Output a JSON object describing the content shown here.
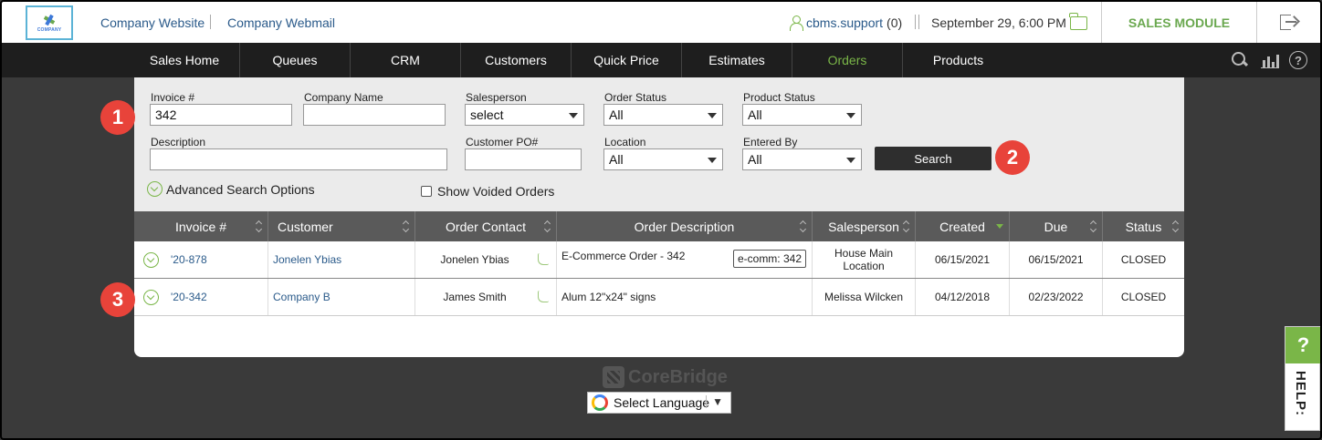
{
  "header": {
    "logo_text": "COMPANY",
    "links": [
      "Company Website",
      "Company Webmail"
    ],
    "user_name": "cbms.support",
    "user_count": "(0)",
    "datetime": "September 29, 6:00 PM",
    "module": "SALES MODULE"
  },
  "nav": {
    "items": [
      "Sales Home",
      "Queues",
      "CRM",
      "Customers",
      "Quick Price",
      "Estimates",
      "Orders",
      "Products"
    ],
    "active": "Orders"
  },
  "filters": {
    "invoice_label": "Invoice #",
    "invoice_value": "342",
    "company_label": "Company Name",
    "company_value": "",
    "salesperson_label": "Salesperson",
    "salesperson_value": "select",
    "order_status_label": "Order Status",
    "order_status_value": "All",
    "product_status_label": "Product Status",
    "product_status_value": "All",
    "description_label": "Description",
    "description_value": "",
    "customer_po_label": "Customer PO#",
    "customer_po_value": "",
    "location_label": "Location",
    "location_value": "All",
    "entered_by_label": "Entered By",
    "entered_by_value": "All",
    "search_label": "Search",
    "advanced_label": "Advanced Search Options",
    "voided_label": "Show Voided Orders"
  },
  "table": {
    "columns": [
      "Invoice #",
      "Customer",
      "Order Contact",
      "Order Description",
      "Salesperson",
      "Created",
      "Due",
      "Status"
    ],
    "rows": [
      {
        "invoice": "'20-878",
        "customer": "Jonelen Ybias",
        "contact": "Jonelen Ybias",
        "description": "E-Commerce Order - 342",
        "tag": "e-comm: 342",
        "salesperson": "House Main Location",
        "created": "06/15/2021",
        "due": "06/15/2021",
        "status": "CLOSED"
      },
      {
        "invoice": "'20-342",
        "customer": "Company B",
        "contact": "James Smith",
        "description": "Alum 12\"x24\" signs",
        "tag": "",
        "salesperson": "Melissa Wilcken",
        "created": "04/12/2018",
        "due": "02/23/2022",
        "status": "CLOSED"
      }
    ]
  },
  "badges": [
    "1",
    "2",
    "3"
  ],
  "footer": {
    "brand": "CoreBridge",
    "language": "Select Language",
    "language_arrow": "▼"
  },
  "help": {
    "icon": "?",
    "label": "HELP:"
  },
  "colors": {
    "accent_green": "#7ab648",
    "link_blue": "#2a5a8a",
    "badge_red": "#e8433a",
    "nav_bg": "#1e1e1e"
  }
}
